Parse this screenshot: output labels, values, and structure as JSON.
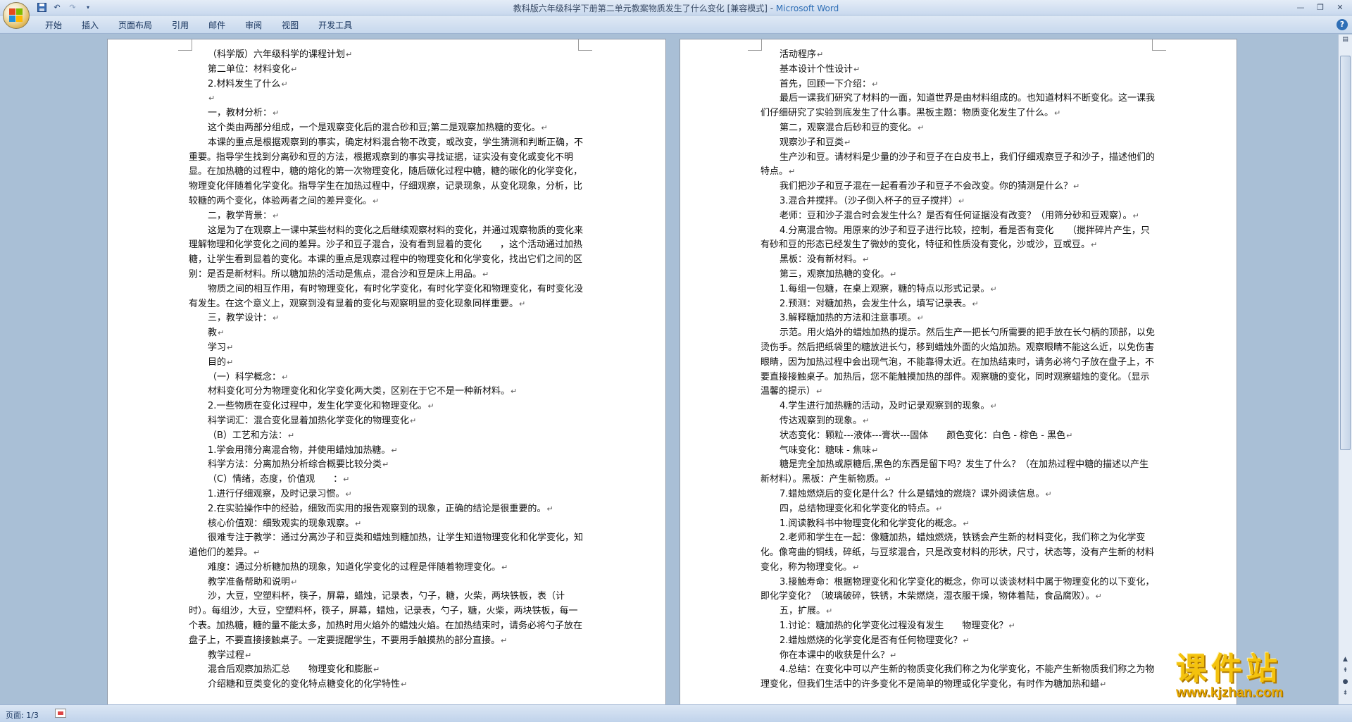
{
  "window": {
    "title": "教科版六年级科学下册第二单元教案物质发生了什么变化 [兼容模式] - ",
    "app_name": "Microsoft Word"
  },
  "qat": {
    "save_icon": "save-icon",
    "undo_icon": "undo-icon",
    "redo_icon": "redo-icon",
    "customize_icon": "customize-qat-icon"
  },
  "ribbon": {
    "tabs": [
      "开始",
      "插入",
      "页面布局",
      "引用",
      "邮件",
      "审阅",
      "视图",
      "开发工具"
    ]
  },
  "status": {
    "page": "页面: 1/3"
  },
  "watermark": {
    "title": "课件站",
    "url": "www.kjzhan.com"
  },
  "left_page": {
    "paragraphs": [
      "（科学版）六年级科学的课程计划",
      "第二单位：材料变化",
      "2.材料发生了什么",
      "",
      "一，教材分析：",
      "这个类由两部分组成，一个是观察变化后的混合砂和豆;第二是观察加热糖的变化。",
      "本课的重点是根据观察到的事实，确定材料混合物不改变，或改变，学生猜测和判断正确，不重要。指导学生找到分离砂和豆的方法，根据观察到的事实寻找证据，证实没有变化或变化不明显。在加热糖的过程中，糖的熔化的第一次物理变化，随后碳化过程中糖，糖的碳化的化学变化，物理变化伴随着化学变化。指导学生在加热过程中，仔细观察，记录现象，从变化现象，分析，比较糖的两个变化，体验两者之间的差异变化。",
      "二，教学背景：",
      "这是为了在观察上一课中某些材料的变化之后继续观察材料的变化，并通过观察物质的变化来理解物理和化学变化之间的差异。沙子和豆子混合，没有看到显着的变化　　，这个活动通过加热糖，让学生看到显着的变化。本课的重点是观察过程中的物理变化和化学变化，找出它们之间的区别：是否是新材料。所以糖加热的活动是焦点，混合沙和豆是床上用品。",
      "物质之间的相互作用，有时物理变化，有时化学变化，有时化学变化和物理变化，有时变化没有发生。在这个意义上，观察到没有显着的变化与观察明显的变化现象同样重要。",
      "三，教学设计：",
      "教",
      "学习",
      "目的",
      "（一）科学概念：",
      "材料变化可分为物理变化和化学变化两大类，区别在于它不是一种新材料。",
      "2.一些物质在变化过程中，发生化学变化和物理变化。",
      "科学词汇：混合变化显着加热化学变化的物理变化",
      "（B）工艺和方法：",
      "1.学会用筛分离混合物，并使用蜡烛加热糖。",
      "科学方法：分离加热分析综合概要比较分类",
      "（C）情绪，态度，价值观　　：",
      "1.进行仔细观察，及时记录习惯。",
      "2.在实验操作中的经验，细致而实用的报告观察到的现象，正确的结论是很重要的。",
      "核心价值观：细致观实的现象观察。",
      "很难专注于教学：通过分离沙子和豆类和蜡烛到糖加热，让学生知道物理变化和化学变化，知道他们的差异。",
      "难度：通过分析糖加热的现象，知道化学变化的过程是伴随着物理变化。",
      "教学准备帮助和说明",
      "沙，大豆，空塑料杯，筷子，屏幕，蜡烛，记录表，勺子，糖，火柴，两块铁板，表（计时）。每组沙，大豆，空塑料杯，筷子，屏幕，蜡烛，记录表，勺子，糖，火柴，两块铁板，每一个表。加热糖，糖的量不能太多，加热时用火焰外的蜡烛火焰。在加热结束时，请务必将勺子放在盘子上，不要直接接触桌子。一定要提醒学生，不要用手触摸热的部分直接。",
      "教学过程",
      "混合后观察加热汇总　　物理变化和膨胀",
      "介绍糖和豆类变化的变化特点糖变化的化学特性"
    ]
  },
  "right_page": {
    "paragraphs": [
      "活动程序",
      "基本设计个性设计",
      "首先，回顾一下介绍：",
      "最后一课我们研究了材料的一面，知道世界是由材料组成的。也知道材料不断变化。这一课我们仔细研究了实验到底发生了什么事。黑板主题：物质变化发生了什么。",
      "第二，观察混合后砂和豆的变化。",
      "观察沙子和豆类",
      "生产沙和豆。请材料是少量的沙子和豆子在白皮书上，我们仔细观察豆子和沙子，描述他们的特点。",
      "我们把沙子和豆子混在一起看看沙子和豆子不会改变。你的猜测是什么？",
      "3.混合并搅拌。（沙子倒入杯子的豆子搅拌）",
      "老师：豆和沙子混合时会发生什么？是否有任何证据没有改变？（用筛分砂和豆观察）。",
      "4.分离混合物。用原来的沙子和豆子进行比较，控制，看是否有变化　　（搅拌碎片产生，只有砂和豆的形态已经发生了微妙的变化，特征和性质没有变化，沙或沙，豆或豆。",
      "黑板：没有新材料。",
      "第三，观察加热糖的变化。",
      "1.每组一包糖，在桌上观察，糖的特点以形式记录。",
      "2.预测：对糖加热，会发生什么，填写记录表。",
      "3.解释糖加热的方法和注意事项。",
      "示范。用火焰外的蜡烛加热的提示。然后生产一把长勺所需要的把手放在长勺柄的顶部，以免烫伤手。然后把纸袋里的糖放进长勺，移到蜡烛外面的火焰加热。观察眼睛不能这么近，以免伤害眼睛，因为加热过程中会出现气泡，不能靠得太近。在加热结束时，请务必将勺子放在盘子上，不要直接接触桌子。加热后，您不能触摸加热的部件。观察糖的变化，同时观察蜡烛的变化。（显示温馨的提示）",
      "4.学生进行加热糖的活动，及时记录观察到的现象。",
      "传达观察到的现象。",
      "状态变化：颗粒---液体---膏状---固体　　颜色变化：白色 - 棕色 - 黑色",
      "气味变化：糖味 - 焦味",
      "糖是完全加热或原糖后,黑色的东西是留下吗？发生了什么？（在加热过程中糖的描述以产生新材料）。黑板：产生新物质。",
      "7.蜡烛燃烧后的变化是什么？什么是蜡烛的燃烧？课外阅读信息。",
      "四，总结物理变化和化学变化的特点。",
      "1.阅读教科书中物理变化和化学变化的概念。",
      "2.老师和学生在一起：像糖加热，蜡烛燃烧，铁锈会产生新的材料变化，我们称之为化学变化。像弯曲的铜线，碎纸，与豆浆混合，只是改变材料的形状，尺寸，状态等，没有产生新的材料变化，称为物理变化。",
      "3.接触寿命：根据物理变化和化学变化的概念，你可以谈谈材料中属于物理变化的以下变化，即化学变化？（玻璃破碎，铁锈，木柴燃烧，湿衣服干燥，物体着陆，食品腐败）。",
      "五，扩展。",
      "1.讨论：糖加热的化学变化过程没有发生　　物理变化？",
      "2.蜡烛燃烧的化学变化是否有任何物理变化？",
      "你在本课中的收获是什么？",
      "4.总结：在变化中可以产生新的物质变化我们称之为化学变化，不能产生新物质我们称之为物理变化，但我们生活中的许多变化不是简单的物理或化学变化，有时作为糖加热和蜡"
    ]
  }
}
